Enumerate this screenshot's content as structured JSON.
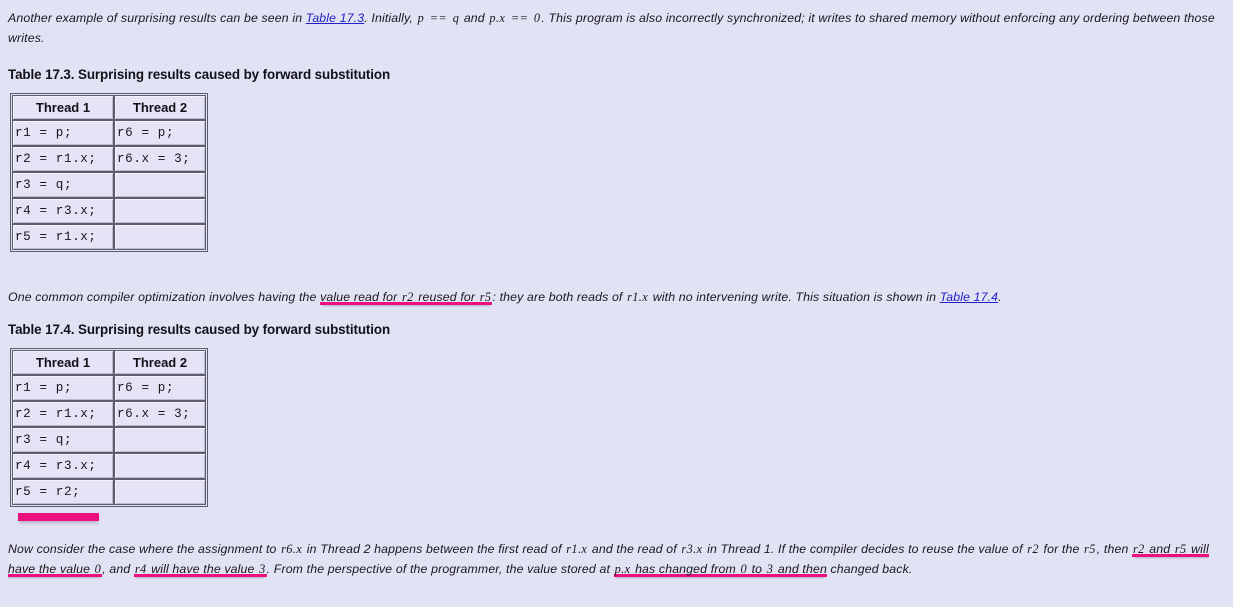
{
  "document": {
    "background_color": "#e2e2f5",
    "highlight_color": "#ec0f7f",
    "link_color": "#2121c4"
  },
  "intro_paragraph": {
    "seg1": "Another example of surprising results can be seen in ",
    "link": "Table 17.3",
    "seg2": ". Initially, ",
    "code1": "p",
    "seg3": " ",
    "code2": "==",
    "seg4": " ",
    "code3": "q",
    "seg5": " and ",
    "code4": "p.x",
    "seg6": " ",
    "code5": "==",
    "seg7": " ",
    "code6": "0",
    "seg8": ". This program is also incorrectly synchronized; it writes to shared memory without enforcing any ordering between those writes."
  },
  "table_17_3": {
    "caption": "Table 17.3. Surprising results caused by forward substitution",
    "headers": [
      "Thread 1",
      "Thread 2"
    ],
    "rows": [
      [
        "r1 = p;",
        "r6 = p;"
      ],
      [
        "r2 = r1.x;",
        "r6.x = 3;"
      ],
      [
        "r3 = q;",
        ""
      ],
      [
        "r4 = r3.x;",
        ""
      ],
      [
        "r5 = r1.x;",
        ""
      ]
    ]
  },
  "middle_paragraph": {
    "seg1": "One common compiler optimization involves having the ",
    "mark1": "value read for ",
    "mark1_code": "r2",
    "mark1_tail": " reused for ",
    "mark1_code2": "r5",
    "seg2": ": they are both reads of ",
    "code1": "r1.x",
    "seg3": " with no intervening write. This situation is shown in ",
    "link": "Table 17.4",
    "seg4": "."
  },
  "table_17_4": {
    "caption": "Table 17.4. Surprising results caused by forward substitution",
    "headers": [
      "Thread 1",
      "Thread 2"
    ],
    "rows": [
      [
        "r1 = p;",
        "r6 = p;"
      ],
      [
        "r2 = r1.x;",
        "r6.x = 3;"
      ],
      [
        "r3 = q;",
        ""
      ],
      [
        "r4 = r3.x;",
        ""
      ],
      [
        "r5 = r2;",
        ""
      ]
    ],
    "highlight_bar_under_last_row": true
  },
  "final_paragraph": {
    "seg1": "Now consider the case where the assignment to ",
    "code1": "r6.x",
    "seg2": " in Thread 2 happens between the first read of ",
    "code2": "r1.x",
    "seg3": " and the read of ",
    "code3": "r3.x",
    "seg4": " in Thread 1. If the compiler decides to reuse the value of ",
    "code4": "r2",
    "seg5": " for the ",
    "code5": "r5",
    "seg6": ", then ",
    "mark1_code": "r2",
    "mark1_mid": " and ",
    "mark1_code2": "r5",
    "mark1_tail": " will have the value ",
    "mark1_val": "0",
    "seg7": ", and ",
    "mark2_code": "r4",
    "mark2_tail": " will have the value ",
    "mark2_val": "3",
    "seg8": ". From the perspective of the programmer, the value stored at ",
    "mark3_code": "p.x",
    "mark3_tail": " has changed from ",
    "mark3_val1": "0",
    "mark3_mid": " to ",
    "mark3_val2": "3",
    "mark3_end": " and then",
    "seg9": " changed back."
  }
}
